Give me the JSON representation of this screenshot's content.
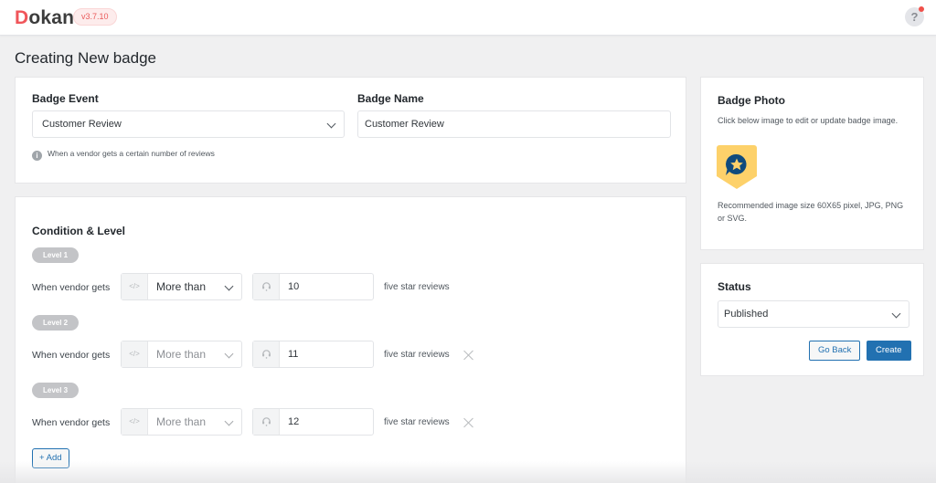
{
  "app": {
    "logo_initial": "D",
    "logo_rest": "okan",
    "version": "v3.7.10",
    "help_label": "?",
    "brand_color": "#f0555a"
  },
  "page": {
    "title": "Creating New badge"
  },
  "event_card": {
    "badge_event_label": "Badge Event",
    "badge_event_value": "Customer Review",
    "badge_name_label": "Badge Name",
    "badge_name_value": "Customer Review",
    "info_icon": "i",
    "info_text": "When a vendor gets a certain number of reviews"
  },
  "conditions": {
    "title": "Condition & Level",
    "levels": [
      {
        "label": "Level 1",
        "prefix": "When vendor gets",
        "operator_icon": "</>",
        "operator": "More than",
        "value": "10",
        "suffix": "five star reviews",
        "removable": false
      },
      {
        "label": "Level 2",
        "prefix": "When vendor gets",
        "operator_icon": "</>",
        "operator": "More than",
        "value": "11",
        "suffix": "five star reviews",
        "removable": true
      },
      {
        "label": "Level 3",
        "prefix": "When vendor gets",
        "operator_icon": "</>",
        "operator": "More than",
        "value": "12",
        "suffix": "five star reviews",
        "removable": true
      }
    ],
    "add_label": "+ Add"
  },
  "photo_card": {
    "title": "Badge Photo",
    "description": "Click below image to edit or update badge image.",
    "recommendation": "Recommended image size 60X65 pixel, JPG, PNG or SVG.",
    "badge_colors": {
      "shield": "#fdd16a",
      "bubble": "#0f4a7d",
      "star": "#fdd16a"
    }
  },
  "status_card": {
    "title": "Status",
    "value": "Published",
    "go_back_label": "Go Back",
    "create_label": "Create",
    "primary_color": "#2271b1"
  }
}
